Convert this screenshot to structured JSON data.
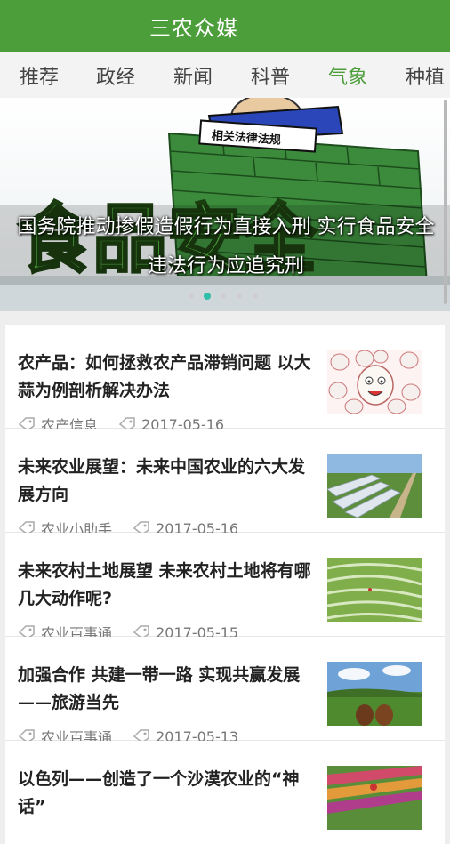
{
  "app": {
    "title": "三农众媒"
  },
  "tabs": [
    {
      "label": "推荐"
    },
    {
      "label": "政经"
    },
    {
      "label": "新闻"
    },
    {
      "label": "科普"
    },
    {
      "label": "气象"
    },
    {
      "label": "种植"
    }
  ],
  "active_tab_index": 4,
  "banner": {
    "caption": "国务院推动掺假造假行为直接入刑 实行食品安全违法行为应追究刑",
    "image_text": [
      "相关法律法规",
      "食品安全"
    ],
    "slide_count": 5,
    "active_slide": 2
  },
  "news": [
    {
      "title": "农产品：如何拯救农产品滞销问题 以大蒜为例剖析解决办法",
      "tag": "农产信息",
      "date": "2017-05-16",
      "image": "garlic-cartoon"
    },
    {
      "title": "未来农业展望：未来中国农业的六大发展方向",
      "tag": "农业小助手",
      "date": "2017-05-16",
      "image": "greenhouse-field"
    },
    {
      "title": "未来农村土地展望 未来农村土地将有哪几大动作呢?",
      "tag": "农业百事通",
      "date": "2017-05-15",
      "image": "rice-terraces"
    },
    {
      "title": "加强合作 共建一带一路 实现共赢发展——旅游当先",
      "tag": "农业百事通",
      "date": "2017-05-13",
      "image": "horses-grassland"
    },
    {
      "title": "以色列——创造了一个沙漠农业的“神话”",
      "tag": "",
      "date": "",
      "image": "flower-field"
    }
  ],
  "colors": {
    "brand": "#4c9e3a",
    "active_tab": "#4c9e3a",
    "active_dot": "#2fbfa8"
  }
}
